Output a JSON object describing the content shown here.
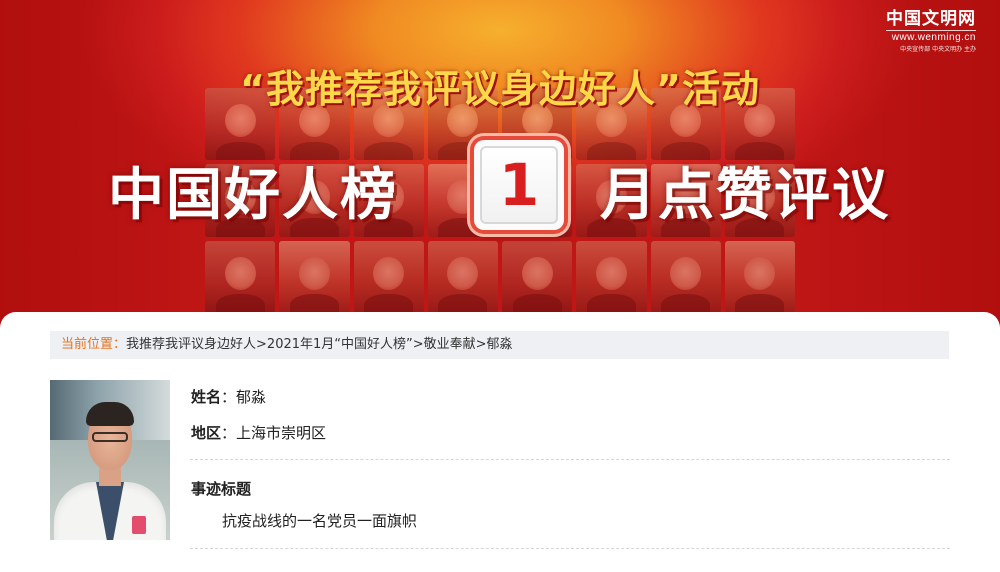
{
  "brand": {
    "name": "中国文明网",
    "url": "www.wenming.cn",
    "sponsor": "中央宣传部  中央文明办  主办"
  },
  "banner": {
    "subtitle": "“我推荐我评议身边好人”活动",
    "title_left": "中国好人榜",
    "month": "1",
    "title_right": "月点赞评议"
  },
  "breadcrumb": {
    "prefix": "当前位置：",
    "items": [
      "我推荐我评议身边好人",
      ">2021年1月“中国好人榜”",
      ">敬业奉献",
      ">郁淼"
    ]
  },
  "person": {
    "name_label": "姓名",
    "name_value": "郁淼",
    "region_label": "地区",
    "region_value": "上海市崇明区",
    "colon": "：",
    "story_heading": "事迹标题",
    "story_title": "抗疫战线的一名党员一面旗帜"
  },
  "colors": {
    "banner_red": "#d11f1f",
    "banner_orange": "#f08a22",
    "subtitle_yellow": "#ffd84a",
    "breadcrumb_prefix": "#e8731f",
    "breadcrumb_bg": "#eef0f4"
  }
}
